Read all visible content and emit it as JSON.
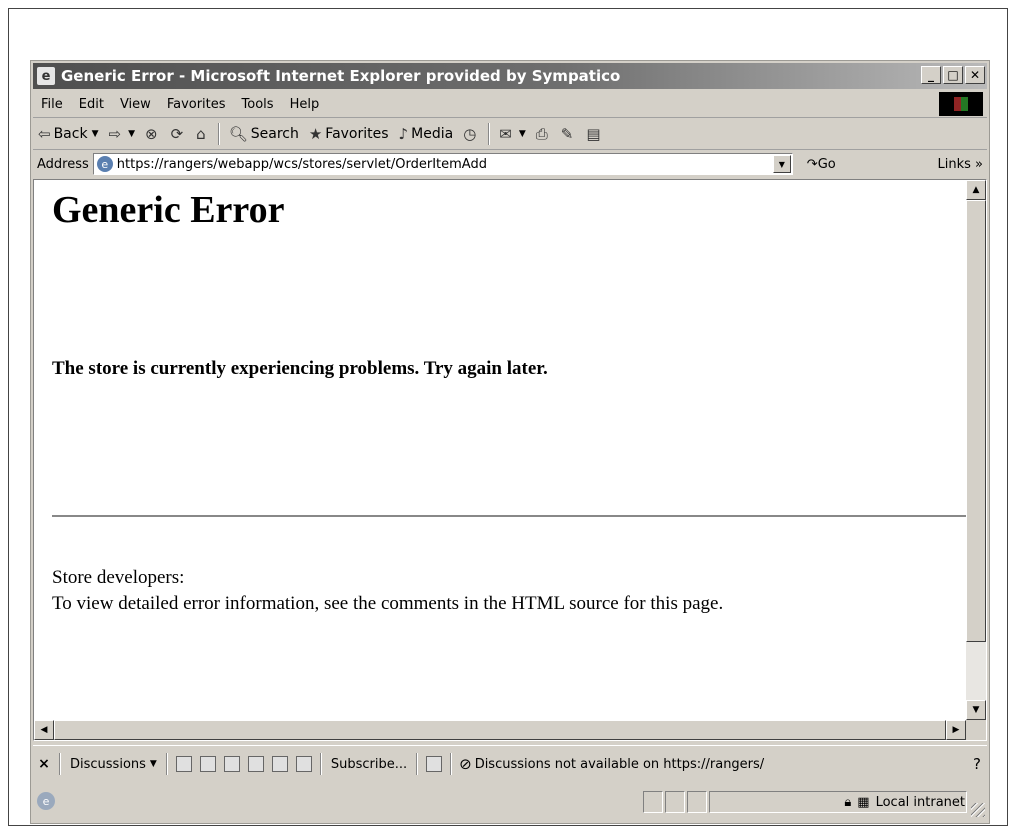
{
  "window": {
    "title": "Generic Error - Microsoft Internet Explorer provided by Sympatico"
  },
  "menu": [
    "File",
    "Edit",
    "View",
    "Favorites",
    "Tools",
    "Help"
  ],
  "toolbar": {
    "back": "Back",
    "search": "Search",
    "favorites": "Favorites",
    "media": "Media"
  },
  "address": {
    "label": "Address",
    "url": "https://rangers/webapp/wcs/stores/servlet/OrderItemAdd",
    "go": "Go",
    "links": "Links"
  },
  "page": {
    "heading": "Generic Error",
    "message": "The store is currently experiencing problems. Try again later.",
    "dev_title": "Store developers:",
    "dev_text": "To view detailed error information, see the comments in the HTML source for this page."
  },
  "discussions": {
    "label": "Discussions",
    "subscribe": "Subscribe...",
    "status": "Discussions not available on https://rangers/"
  },
  "status": {
    "zone": "Local intranet"
  },
  "colors": {
    "chrome": "#d4d0c8",
    "titlebar": "#5a5a5a"
  }
}
